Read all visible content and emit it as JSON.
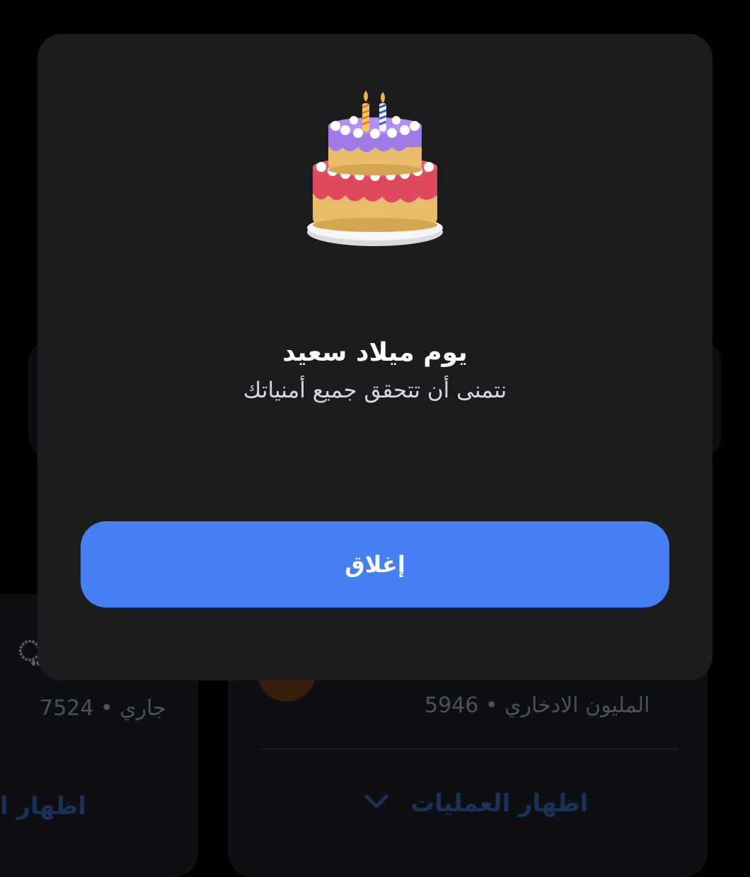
{
  "dialog": {
    "title": "يوم ميلاد سعيد",
    "subtitle": "نتمنى أن تتحقق جميع أمنياتك",
    "close_label": "إغلاق",
    "illustration": "birthday-cake-icon"
  },
  "background": {
    "left_card": {
      "subtitle": "جاري • 7524",
      "link": "اظهار ا"
    },
    "right_card": {
      "subtitle": "المليون الادخاري • 5946",
      "link": "اظهار العمليات",
      "link_icon": "chevron-down-icon"
    }
  },
  "colors": {
    "accent": "#4480f2",
    "modal_bg": "#1c1c1f",
    "page_bg": "#000000"
  }
}
